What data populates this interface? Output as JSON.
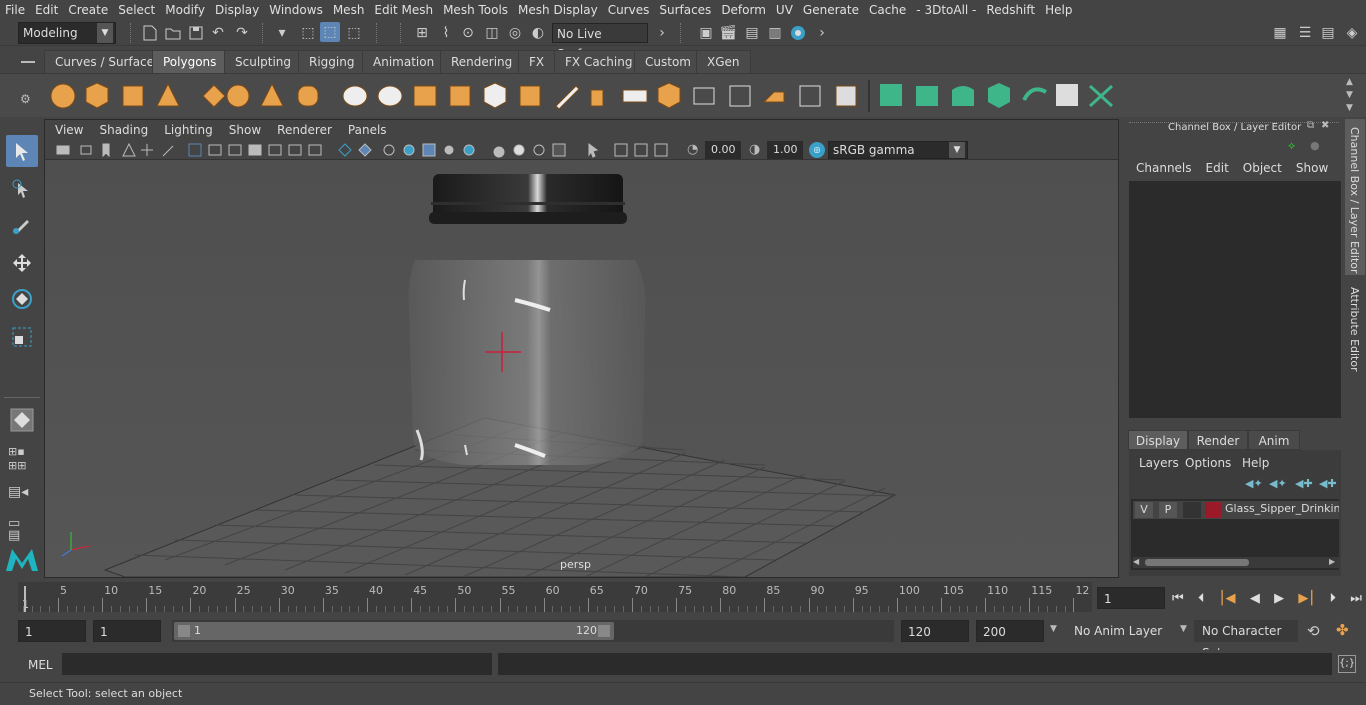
{
  "menu": [
    "File",
    "Edit",
    "Create",
    "Select",
    "Modify",
    "Display",
    "Windows",
    "Mesh",
    "Edit Mesh",
    "Mesh Tools",
    "Mesh Display",
    "Curves",
    "Surfaces",
    "Deform",
    "UV",
    "Generate",
    "Cache",
    "- 3DtoAll -",
    "Redshift",
    "Help"
  ],
  "status": {
    "mode": "Modeling",
    "live_surface": "No Live Surface"
  },
  "shelf_tabs": [
    "Curves / Surfaces",
    "Polygons",
    "Sculpting",
    "Rigging",
    "Animation",
    "Rendering",
    "FX",
    "FX Caching",
    "Custom",
    "XGen"
  ],
  "shelf_active": "Polygons",
  "viewport": {
    "menu": [
      "View",
      "Shading",
      "Lighting",
      "Show",
      "Renderer",
      "Panels"
    ],
    "exposure": "0.00",
    "gamma": "1.00",
    "color_space": "sRGB gamma",
    "camera_label": "persp"
  },
  "channel_box": {
    "title": "Channel Box / Layer Editor",
    "menu": [
      "Channels",
      "Edit",
      "Object",
      "Show"
    ],
    "layer_tabs": [
      "Display",
      "Render",
      "Anim"
    ],
    "layer_tab_active": "Display",
    "layer_menu": [
      "Layers",
      "Options",
      "Help"
    ],
    "layer": {
      "v": "V",
      "p": "P",
      "name": "Glass_Sipper_Drinking",
      "color": "#9b1a2a"
    }
  },
  "side_tabs": [
    "Channel Box / Layer Editor",
    "Attribute Editor"
  ],
  "timeline": {
    "labels": [
      "5",
      "10",
      "15",
      "20",
      "25",
      "30",
      "35",
      "40",
      "45",
      "50",
      "55",
      "60",
      "65",
      "70",
      "75",
      "80",
      "85",
      "90",
      "95",
      "100",
      "105",
      "110",
      "115",
      "12"
    ],
    "first_label": "1",
    "current_frame": "1"
  },
  "range": {
    "start": "1",
    "playback_start": "1",
    "slider_start": "1",
    "slider_end": "120",
    "playback_end": "120",
    "end": "200",
    "anim_layer": "No Anim Layer",
    "character_set": "No Character Set"
  },
  "command": {
    "lang": "MEL"
  },
  "help_line": "Select Tool: select an object",
  "colors": {
    "accent": "#5d85b5",
    "shelf_orange": "#e8a24c",
    "shelf_green": "#3fb58a"
  }
}
